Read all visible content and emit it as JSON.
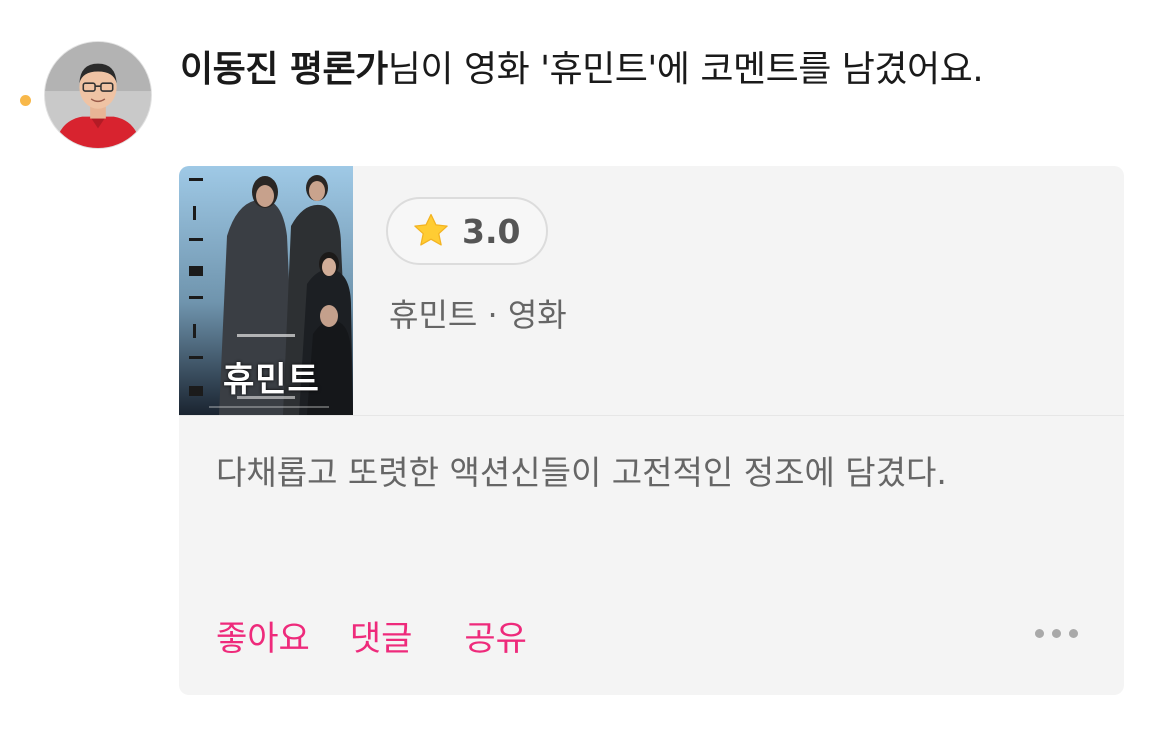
{
  "notification": {
    "user_name": "이동진 평론가",
    "message_suffix": "님이 영화 '휴민트'에 코멘트를 남겼어요.",
    "unread_dot_color": "#f8b84a",
    "avatar_icon": "profile-photo"
  },
  "card": {
    "poster_title": "휴민트",
    "rating_icon": "star-icon",
    "rating": "3.0",
    "meta": "휴민트 · 영화",
    "comment": "다채롭고 또렷한 액션신들이 고전적인 정조에 담겼다.",
    "actions": {
      "like_label": "좋아요",
      "reply_label": "댓글",
      "share_label": "공유",
      "more_icon": "more-dots-icon"
    },
    "accent_color": "#ee2a7b"
  }
}
